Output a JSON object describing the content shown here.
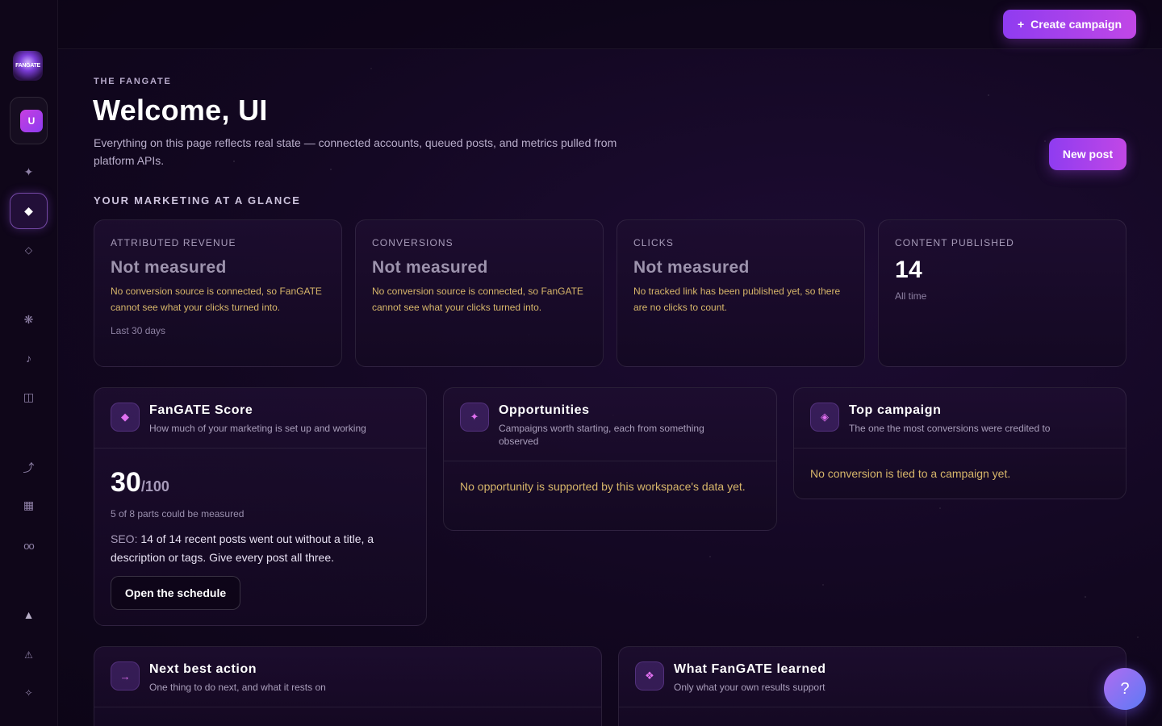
{
  "sidebar": {
    "logo_text": "FANGATE",
    "user_initial": "U",
    "items": [
      {
        "name": "sparkle",
        "glyph": "✦"
      },
      {
        "name": "diamond",
        "glyph": "◆"
      },
      {
        "name": "diamond-outline",
        "glyph": "◇"
      },
      {
        "name": "asterisk",
        "glyph": "❋"
      },
      {
        "name": "music-note",
        "glyph": "♪"
      },
      {
        "name": "columns",
        "glyph": "◫"
      },
      {
        "name": "route",
        "glyph": "⤴"
      },
      {
        "name": "calendar",
        "glyph": "▦"
      },
      {
        "name": "infinity",
        "glyph": "oo"
      },
      {
        "name": "triangle",
        "glyph": "▲"
      },
      {
        "name": "warning",
        "glyph": "⚠"
      },
      {
        "name": "star-small",
        "glyph": "✧"
      }
    ]
  },
  "topbar": {
    "create_label": "Create campaign",
    "create_icon": "+"
  },
  "header": {
    "eyebrow": "THE FANGATE",
    "title": "Welcome, UI",
    "subtitle": "Everything on this page reflects real state — connected accounts, queued posts, and metrics pulled from platform APIs.",
    "new_post_label": "New post"
  },
  "glance": {
    "label": "YOUR MARKETING AT A GLANCE",
    "cards": [
      {
        "label": "ATTRIBUTED REVENUE",
        "value": "Not measured",
        "note": "No conversion source is connected, so FanGATE cannot see what your clicks turned into.",
        "foot": "Last 30 days"
      },
      {
        "label": "CONVERSIONS",
        "value": "Not measured",
        "note": "No conversion source is connected, so FanGATE cannot see what your clicks turned into."
      },
      {
        "label": "CLICKS",
        "value": "Not measured",
        "note": "No tracked link has been published yet, so there are no clicks to count."
      },
      {
        "label": "CONTENT PUBLISHED",
        "value": "14",
        "foot": "All time"
      }
    ]
  },
  "score": {
    "icon": "◆",
    "title": "FanGATE Score",
    "subtitle": "How much of your marketing is set up and working",
    "value": "30",
    "max": "/100",
    "measured": "5 of 8 parts could be measured",
    "seo_key": "SEO:",
    "seo_text": "14 of 14 recent posts went out without a title, a description or tags. Give every post all three.",
    "button": "Open the schedule"
  },
  "opportunities": {
    "icon": "✦",
    "title": "Opportunities",
    "subtitle": "Campaigns worth starting, each from something observed",
    "note": "No opportunity is supported by this workspace's data yet."
  },
  "top_campaign": {
    "icon": "◈",
    "title": "Top campaign",
    "subtitle": "The one the most conversions were credited to",
    "note": "No conversion is tied to a campaign yet."
  },
  "next_action": {
    "icon": "→",
    "title": "Next best action",
    "subtitle": "One thing to do next, and what it rests on"
  },
  "learned": {
    "icon": "❖",
    "title": "What FanGATE learned",
    "subtitle": "Only what your own results support"
  },
  "help": {
    "label": "?"
  }
}
